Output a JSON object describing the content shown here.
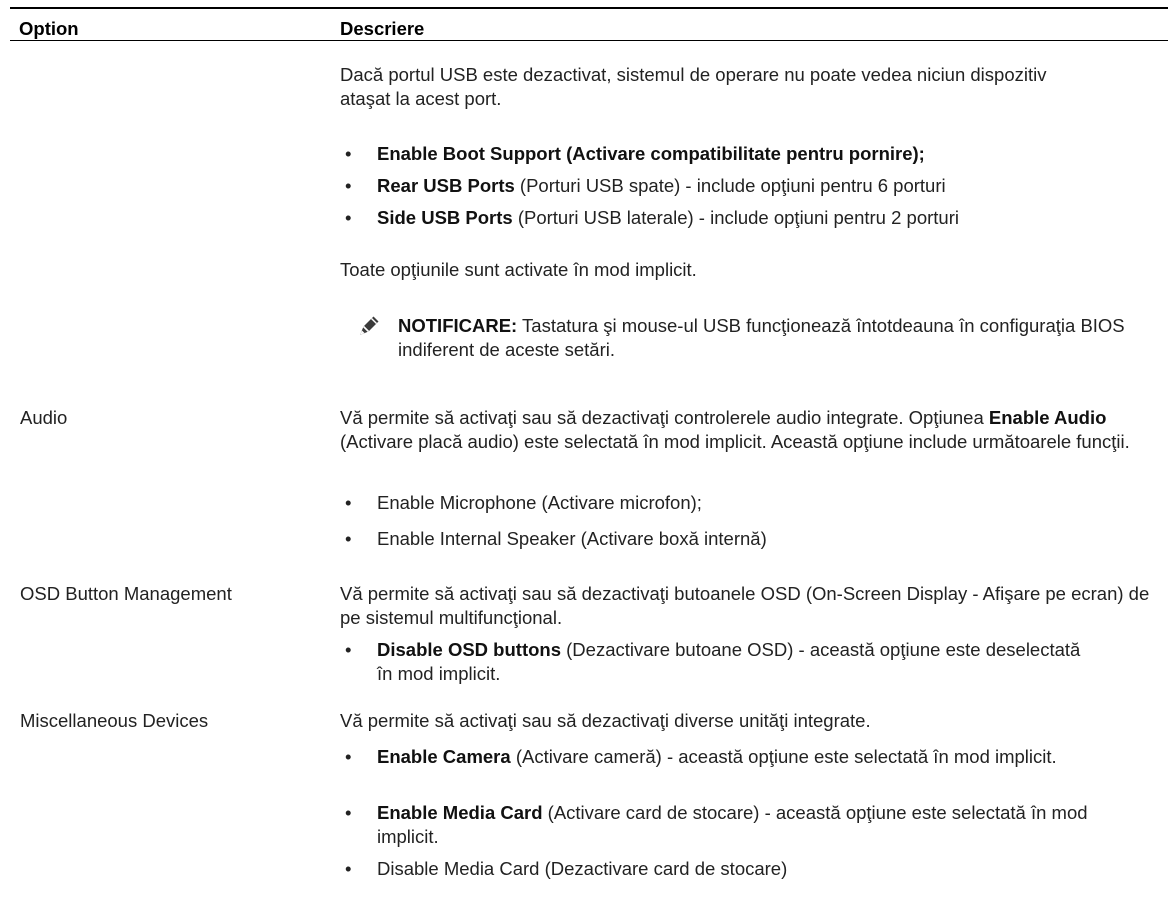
{
  "header": {
    "col_option": "Option",
    "col_description": "Descriere"
  },
  "usb": {
    "intro": "Dacă portul USB este dezactivat, sistemul de operare nu poate vedea niciun dispozitiv ataşat la acest port.",
    "bullets": [
      {
        "bold": "Enable Boot Support (Activare compatibilitate pentru pornire);",
        "rest": ""
      },
      {
        "bold": "Rear USB Ports",
        "rest": " (Porturi USB spate) - include opţiuni pentru 6 porturi"
      },
      {
        "bold": "Side USB Ports",
        "rest": " (Porturi USB laterale) - include opţiuni pentru 2 porturi"
      }
    ],
    "default_text": "Toate opţiunile sunt activate în mod implicit.",
    "note_label": "NOTIFICARE:",
    "note_text": " Tastatura şi mouse-ul USB funcţionează întotdeauna în configuraţia BIOS indiferent de aceste setări.",
    "note_icon": "pencil-note-icon"
  },
  "audio": {
    "label": "Audio",
    "desc_part1": "Vă permite să activaţi sau să dezactivaţi controlerele audio integrate. Opţiunea ",
    "desc_bold": "Enable Audio",
    "desc_part2": " (Activare placă audio) este selectată în mod implicit. Această opţiune include următoarele funcţii.",
    "bullets": [
      "Enable Microphone (Activare microfon);",
      "Enable Internal Speaker (Activare boxă internă)"
    ]
  },
  "osd": {
    "label": "OSD Button Management",
    "desc": "Vă permite să activaţi sau să dezactivaţi butoanele OSD (On-Screen Display - Afişare pe ecran) de pe sistemul multifuncţional.",
    "bullet_bold": "Disable OSD buttons",
    "bullet_rest": " (Dezactivare butoane OSD) - această opţiune este deselectată în mod implicit."
  },
  "misc": {
    "label": "Miscellaneous Devices",
    "desc": "Vă permite să activaţi sau să dezactivaţi diverse unităţi integrate.",
    "bullets": [
      {
        "bold": "Enable Camera",
        "rest": " (Activare cameră) - această opţiune este selectată în mod implicit."
      },
      {
        "bold": "Enable Media Card",
        "rest": " (Activare card de stocare) - această opţiune este selectată în mod implicit."
      },
      {
        "bold": "",
        "rest": "Disable Media Card (Dezactivare card de stocare)"
      }
    ]
  },
  "bullet_char": "•"
}
